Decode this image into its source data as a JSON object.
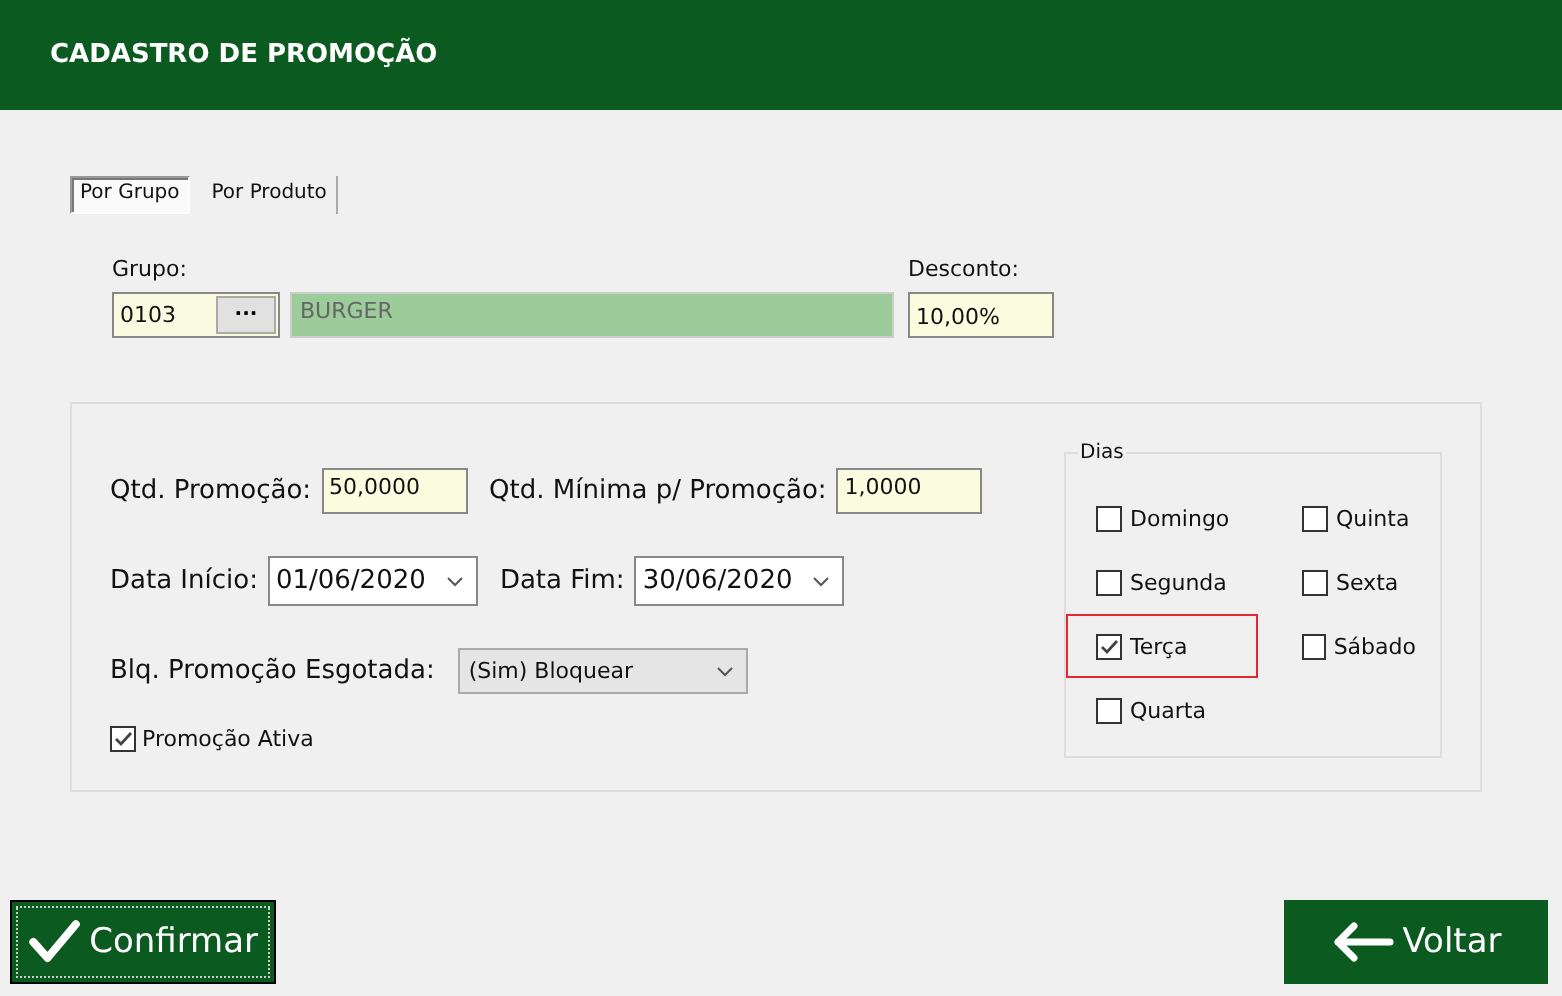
{
  "window": {
    "title": "CADASTRO DE PROMOÇÃO"
  },
  "tabs": [
    {
      "label": "Por Grupo",
      "selected": true
    },
    {
      "label": "Por Produto",
      "selected": false
    }
  ],
  "grupo": {
    "label": "Grupo:",
    "code": "0103",
    "lookup_button": "···",
    "name": "BURGER"
  },
  "desconto": {
    "label": "Desconto:",
    "value": "10,00%"
  },
  "qtd_promocao": {
    "label": "Qtd. Promoção:",
    "value": "50,0000"
  },
  "qtd_minima": {
    "label": "Qtd. Mínima p/ Promoção:",
    "value": "1,0000"
  },
  "data_inicio": {
    "label": "Data Início:",
    "value": "01/06/2020"
  },
  "data_fim": {
    "label": "Data Fim:",
    "value": "30/06/2020"
  },
  "bloqueio": {
    "label": "Blq. Promoção Esgotada:",
    "value": "(Sim) Bloquear"
  },
  "promocao_ativa": {
    "label": "Promoção Ativa",
    "checked": true
  },
  "dias": {
    "title": "Dias",
    "items": [
      {
        "label": "Domingo",
        "checked": false,
        "highlighted": false
      },
      {
        "label": "Segunda",
        "checked": false,
        "highlighted": false
      },
      {
        "label": "Terça",
        "checked": true,
        "highlighted": true
      },
      {
        "label": "Quarta",
        "checked": false,
        "highlighted": false
      },
      {
        "label": "Quinta",
        "checked": false,
        "highlighted": false
      },
      {
        "label": "Sexta",
        "checked": false,
        "highlighted": false
      },
      {
        "label": "Sábado",
        "checked": false,
        "highlighted": false
      }
    ]
  },
  "buttons": [
    {
      "label": "Confirmar",
      "kind": "confirm"
    },
    {
      "label": "Voltar",
      "kind": "back"
    }
  ]
}
